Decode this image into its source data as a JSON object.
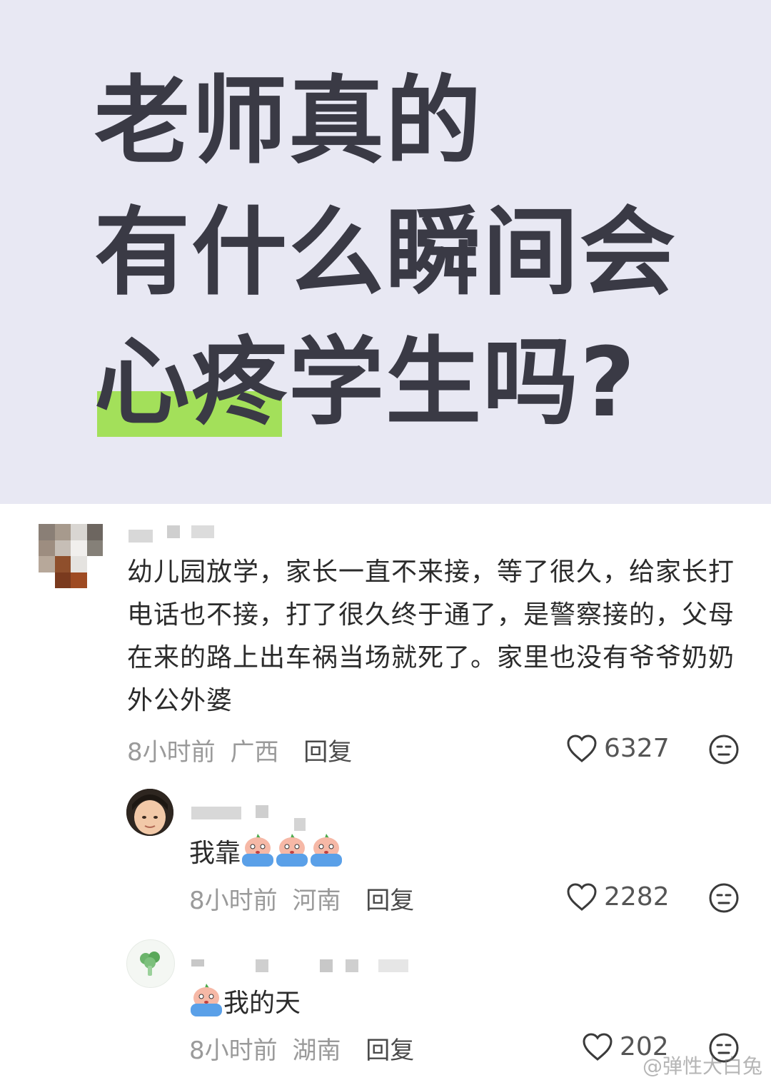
{
  "banner": {
    "title_line1": "老师真的",
    "title_line2": "有什么瞬间会",
    "title_line3": "心疼学生吗?",
    "highlight_color": "#a3e05a",
    "background_color": "#e8e8f3"
  },
  "comment_main": {
    "text": "幼儿园放学，家长一直不来接，等了很久，给家长打电话也不接，打了很久终于通了，是警察接的，父母在来的路上出车祸当场就死了。家里也没有爷爷奶奶外公外婆",
    "time": "8小时前",
    "location": "广西",
    "reply_label": "回复",
    "likes": "6327"
  },
  "replies": [
    {
      "text": "我靠",
      "time": "8小时前",
      "location": "河南",
      "reply_label": "回复",
      "likes": "2282"
    },
    {
      "text": "我的天",
      "time": "8小时前",
      "location": "湖南",
      "reply_label": "回复",
      "likes": "202"
    }
  ],
  "watermark": "@弹性大白兔"
}
